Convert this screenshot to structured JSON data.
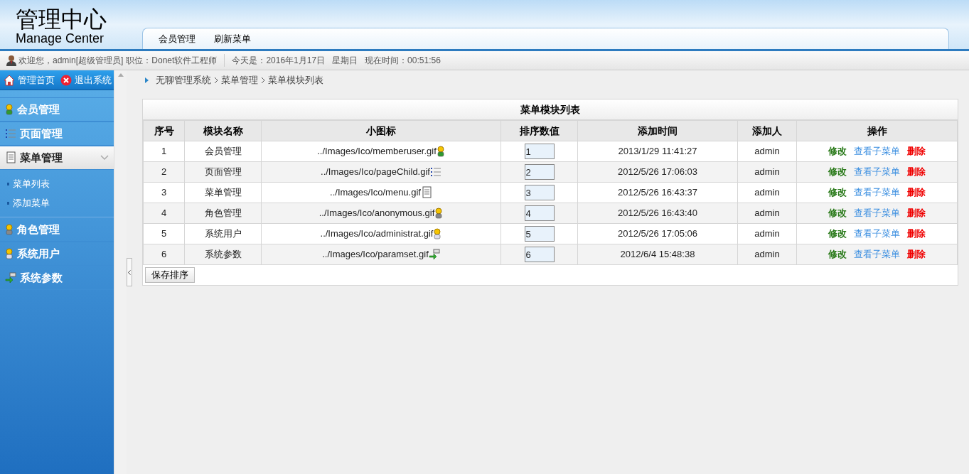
{
  "header": {
    "logo_title": "管理中心",
    "logo_subtitle": "Manage Center",
    "tabs": [
      {
        "label": "会员管理"
      },
      {
        "label": "刷新菜单"
      }
    ]
  },
  "info_bar": {
    "welcome": "欢迎您，admin[超级管理员]",
    "position": "职位：Donet软件工程师",
    "today": "今天是：2016年1月17日",
    "weekday": "星期日",
    "time": "现在时间：00:51:56"
  },
  "sidebar": {
    "top_links": [
      {
        "label": "管理首页"
      },
      {
        "label": "退出系统"
      }
    ],
    "items": [
      {
        "label": "会员管理",
        "expanded": false
      },
      {
        "label": "页面管理",
        "expanded": false
      },
      {
        "label": "菜单管理",
        "expanded": true,
        "children": [
          {
            "label": "菜单列表"
          },
          {
            "label": "添加菜单"
          }
        ]
      },
      {
        "label": "角色管理",
        "expanded": false
      },
      {
        "label": "系统用户",
        "expanded": false
      },
      {
        "label": "系统参数",
        "expanded": false
      }
    ]
  },
  "breadcrumb": [
    "无聊管理系统",
    "菜单管理",
    "菜单模块列表"
  ],
  "table": {
    "title": "菜单模块列表",
    "columns": [
      "序号",
      "模块名称",
      "小图标",
      "排序数值",
      "添加时间",
      "添加人",
      "操作"
    ],
    "rows": [
      {
        "index": "1",
        "name": "会员管理",
        "icon_path": "../Images/Ico/memberuser.gif",
        "sort": "1",
        "added": "2013/1/29 11:41:27",
        "by": "admin",
        "actions": [
          "修改",
          "查看子菜单",
          "删除"
        ]
      },
      {
        "index": "2",
        "name": "页面管理",
        "icon_path": "../Images/Ico/pageChild.gif",
        "sort": "2",
        "added": "2012/5/26 17:06:03",
        "by": "admin",
        "actions": [
          "修改",
          "查看子菜单",
          "删除"
        ]
      },
      {
        "index": "3",
        "name": "菜单管理",
        "icon_path": "../Images/Ico/menu.gif",
        "sort": "3",
        "added": "2012/5/26 16:43:37",
        "by": "admin",
        "actions": [
          "修改",
          "查看子菜单",
          "删除"
        ]
      },
      {
        "index": "4",
        "name": "角色管理",
        "icon_path": "../Images/Ico/anonymous.gif",
        "sort": "4",
        "added": "2012/5/26 16:43:40",
        "by": "admin",
        "actions": [
          "修改",
          "查看子菜单",
          "删除"
        ]
      },
      {
        "index": "5",
        "name": "系统用户",
        "icon_path": "../Images/Ico/administrat.gif",
        "sort": "5",
        "added": "2012/5/26 17:05:06",
        "by": "admin",
        "actions": [
          "修改",
          "查看子菜单",
          "删除"
        ]
      },
      {
        "index": "6",
        "name": "系统参数",
        "icon_path": "../Images/Ico/paramset.gif",
        "sort": "6",
        "added": "2012/6/4 15:48:38",
        "by": "admin",
        "actions": [
          "修改",
          "查看子菜单",
          "删除"
        ]
      }
    ],
    "save_button": "保存排序"
  }
}
